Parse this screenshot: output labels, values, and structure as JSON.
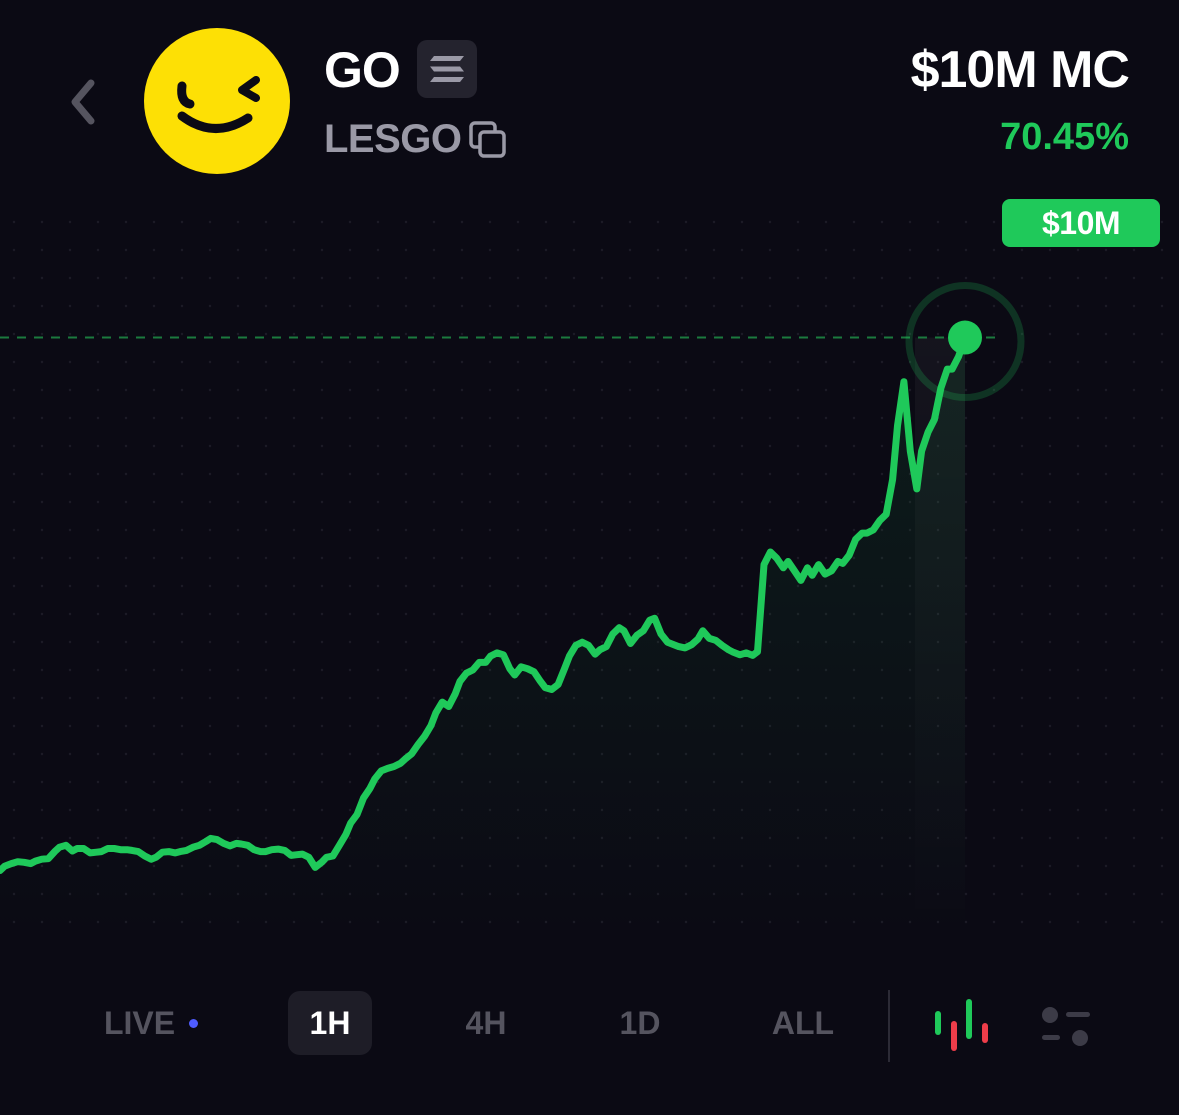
{
  "header": {
    "ticker": "GO",
    "name": "LESGO",
    "market_cap": "$10M MC",
    "change": "70.45%"
  },
  "chart_data": {
    "type": "line",
    "x": [
      0,
      3,
      7,
      11,
      15,
      19,
      22,
      26,
      30,
      34,
      37,
      41,
      45,
      48,
      52,
      56,
      60,
      63,
      67,
      71,
      75,
      79,
      82,
      86,
      90,
      94,
      97,
      101,
      105,
      109,
      112,
      116,
      120,
      124,
      128,
      131,
      135,
      139,
      143,
      147,
      150,
      154,
      158,
      162,
      165,
      169,
      173,
      177,
      181,
      184,
      188,
      192,
      196,
      200,
      203,
      207,
      211,
      215,
      218,
      222,
      226,
      230,
      233,
      237,
      241,
      245,
      249,
      252,
      256,
      260,
      264,
      268,
      271,
      275,
      279,
      283,
      286,
      290,
      294,
      298,
      302,
      305,
      309,
      313,
      317,
      320,
      324,
      328,
      332,
      336,
      339,
      343,
      347,
      351,
      354,
      358,
      362,
      366,
      370,
      373,
      377,
      381,
      385,
      388,
      392,
      396,
      400,
      404,
      407,
      411,
      415,
      419,
      422,
      426,
      430,
      434,
      437,
      441,
      445,
      449,
      453,
      456,
      460,
      464,
      468,
      471,
      475,
      479,
      483,
      487,
      490,
      494,
      498,
      502,
      505,
      509,
      513,
      517,
      521,
      524,
      528,
      532,
      536,
      539,
      543,
      547,
      551,
      555,
      558,
      562,
      566,
      570,
      573,
      577,
      581,
      585,
      589,
      592,
      596,
      600
    ],
    "values": [
      0.15,
      0.22,
      0.26,
      0.29,
      0.28,
      0.26,
      0.3,
      0.33,
      0.34,
      0.45,
      0.52,
      0.55,
      0.46,
      0.5,
      0.5,
      0.43,
      0.44,
      0.45,
      0.5,
      0.5,
      0.48,
      0.48,
      0.47,
      0.45,
      0.38,
      0.33,
      0.36,
      0.44,
      0.45,
      0.43,
      0.45,
      0.47,
      0.52,
      0.55,
      0.61,
      0.66,
      0.64,
      0.58,
      0.54,
      0.58,
      0.57,
      0.55,
      0.48,
      0.45,
      0.45,
      0.48,
      0.49,
      0.47,
      0.39,
      0.4,
      0.41,
      0.36,
      0.2,
      0.28,
      0.36,
      0.38,
      0.55,
      0.72,
      0.9,
      1.04,
      1.3,
      1.45,
      1.6,
      1.73,
      1.77,
      1.8,
      1.85,
      1.92,
      2.0,
      2.15,
      2.28,
      2.45,
      2.65,
      2.82,
      2.75,
      2.95,
      3.15,
      3.28,
      3.33,
      3.45,
      3.45,
      3.55,
      3.6,
      3.57,
      3.35,
      3.25,
      3.38,
      3.35,
      3.3,
      3.15,
      3.05,
      3.02,
      3.1,
      3.35,
      3.55,
      3.72,
      3.77,
      3.72,
      3.58,
      3.65,
      3.7,
      3.9,
      4.0,
      3.95,
      3.75,
      3.88,
      3.95,
      4.12,
      4.15,
      3.9,
      3.77,
      3.73,
      3.7,
      3.68,
      3.73,
      3.82,
      3.95,
      3.83,
      3.8,
      3.72,
      3.65,
      3.61,
      3.57,
      3.6,
      3.56,
      3.62,
      5.0,
      5.2,
      5.1,
      4.95,
      5.05,
      4.9,
      4.75,
      4.95,
      4.83,
      5.0,
      4.85,
      4.9,
      5.05,
      5.02,
      5.15,
      5.4,
      5.5,
      5.5,
      5.55,
      5.7,
      5.8,
      6.35,
      7.2,
      7.9,
      6.8,
      6.2,
      6.8,
      7.1,
      7.3,
      7.8,
      8.1,
      8.1,
      8.3,
      8.6,
      8.8,
      8.0,
      9.0,
      9.3,
      10.0
    ],
    "ylim": [
      0,
      10.4
    ],
    "xlim": [
      0,
      600
    ],
    "grid": true,
    "last_label": "$10M",
    "line_color": "#1fc95a"
  },
  "timeframes": [
    {
      "label": "LIVE",
      "active": false
    },
    {
      "label": "1H",
      "active": true
    },
    {
      "label": "4H",
      "active": false
    },
    {
      "label": "1D",
      "active": false
    },
    {
      "label": "ALL",
      "active": false
    }
  ],
  "icons": {
    "back": "chevron-left-icon",
    "chain": "solana-icon",
    "copy": "copy-icon",
    "candles": "candlestick-icon",
    "toggle": "settings-toggle-icon"
  },
  "colors": {
    "background": "#0b0a14",
    "accent_green": "#1fc95a",
    "live_dot": "#4f5dff",
    "muted_text": "#9a99a6",
    "candle_red": "#ee3d4a"
  }
}
